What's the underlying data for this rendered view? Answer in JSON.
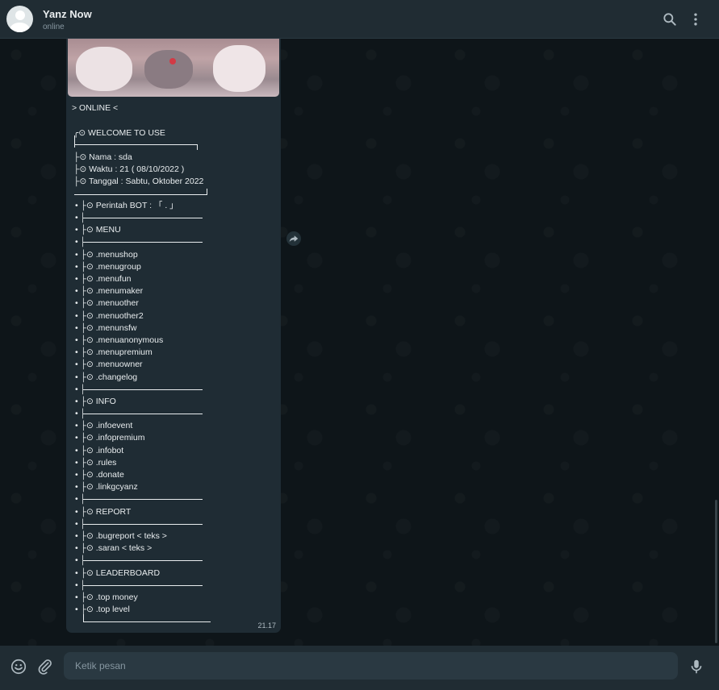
{
  "header": {
    "name": "Yanz Now",
    "status": "online"
  },
  "message": {
    "title": "> ONLINE <",
    "welcome": "╭⊙ WELCOME TO USE",
    "info_lines": [
      "├⊙ Nama : sda",
      "├⊙ Waktu : 21 ( 08/10/2022 )",
      "├⊙ Tanggal : Sabtu, Oktober 2022"
    ],
    "body_lines": [
      "• ├⊙ Perintah BOT : 「 . 」",
      "• │",
      "• ├⊙ MENU",
      "• │",
      "• ├⊙ .menushop",
      "• ├⊙ .menugroup",
      "• ├⊙ .menufun",
      "• ├⊙ .menumaker",
      "• ├⊙ .menuother",
      "• ├⊙ .menuother2",
      "• ├⊙ .menunsfw",
      "• ├⊙ .menuanonymous",
      "• ├⊙ .menupremium",
      "• ├⊙ .menuowner",
      "• ├⊙ .changelog",
      "• │",
      "• ├⊙ INFO",
      "• │",
      "• ├⊙ .infoevent",
      "• ├⊙ .infopremium",
      "• ├⊙ .infobot",
      "• ├⊙ .rules",
      "• ├⊙ .donate",
      "• ├⊙ .linkgcyanz",
      "• │",
      "• ├⊙ REPORT",
      "• │",
      "• ├⊙ .bugreport < teks >",
      "• ├⊙ .saran < teks >",
      "• │",
      "• ├⊙ LEADERBOARD",
      "• │",
      "• ├⊙ .top money",
      "• ├⊙ .top level"
    ],
    "time": "21.17"
  },
  "footer": {
    "placeholder": "Ketik pesan"
  },
  "icons": {
    "search": "search-icon",
    "menu": "more-vertical-icon",
    "emoji": "emoji-icon",
    "attach": "paperclip-icon",
    "mic": "microphone-icon",
    "forward": "forward-icon"
  },
  "colors": {
    "header_bg": "#202c33",
    "chat_bg": "#0b141a",
    "bubble_bg": "#1f2c34",
    "text": "#e9edef",
    "muted": "#8696a0"
  }
}
